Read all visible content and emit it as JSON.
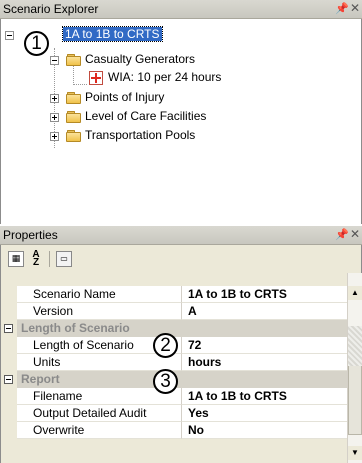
{
  "scenario_explorer": {
    "title": "Scenario Explorer",
    "pin_icon": "pin-icon",
    "close_icon": "close-icon",
    "tree": {
      "root": "1A to 1B to CRTS",
      "casualty_generators": "Casualty Generators",
      "wia": "WIA: 10 per 24 hours",
      "points_of_injury": "Points of Injury",
      "level_of_care": "Level of Care Facilities",
      "transportation_pools": "Transportation Pools"
    }
  },
  "properties": {
    "title": "Properties",
    "toolbar": {
      "categorized_icon": "categorized-icon",
      "alphabetical_icon": "sort-alphabetical-icon",
      "property_pages_icon": "property-pages-icon"
    },
    "rows": [
      {
        "name": "Scenario Name",
        "value": "1A to 1B to CRTS"
      },
      {
        "name": "Version",
        "value": "A"
      },
      {
        "category": "Length of Scenario"
      },
      {
        "name": "Length of Scenario",
        "value": "72"
      },
      {
        "name": "Units",
        "value": "hours"
      },
      {
        "category": "Report"
      },
      {
        "name": "Filename",
        "value": "1A to 1B to CRTS"
      },
      {
        "name": "Output Detailed Audit",
        "value": "Yes"
      },
      {
        "name": "Overwrite",
        "value": "No"
      }
    ]
  },
  "callouts": [
    "1",
    "2",
    "3"
  ],
  "colors": {
    "selection": "#316ac5",
    "category_background": "#d6d3c9",
    "panel_background": "#ece9d8"
  }
}
